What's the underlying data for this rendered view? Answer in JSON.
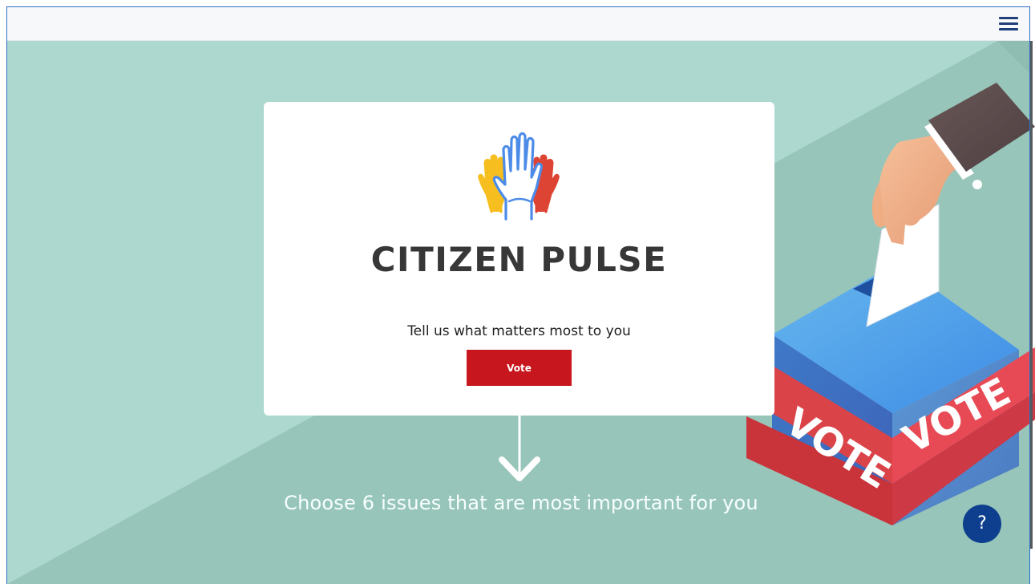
{
  "app": {
    "title": "CITIZEN PULSE"
  },
  "header": {
    "menu_icon": "hamburger-menu-icon"
  },
  "hero": {
    "card": {
      "logo_icon": "raised-hands-icon",
      "title": "CITIZEN PULSE",
      "subtitle": "Tell us what matters most to you",
      "vote_button_label": "Vote"
    },
    "caption": "Choose 6 issues that are most important for you",
    "arrow_icon": "arrow-down-icon",
    "illustration": {
      "name": "ballot-box-illustration",
      "banner_text_left": "VOTE",
      "banner_text_right": "VOTE"
    }
  },
  "help": {
    "label": "?"
  },
  "colors": {
    "background_light": "#acd8cf",
    "background_dark": "#98c5ba",
    "vote_red": "#c7161d",
    "help_blue": "#0d3f8e",
    "menu_blue": "#1f3f7a"
  }
}
